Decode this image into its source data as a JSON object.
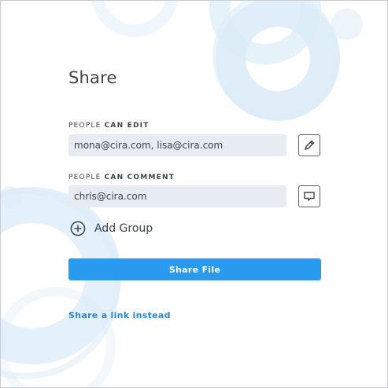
{
  "dialog": {
    "title": "Share",
    "edit_section": {
      "label_prefix": "PEOPLE",
      "label_emphasis": "CAN EDIT",
      "value": "mona@cira.com, lisa@cira.com",
      "icon": "pencil-icon"
    },
    "comment_section": {
      "label_prefix": "PEOPLE",
      "label_emphasis": "CAN COMMENT",
      "value": "chris@cira.com",
      "icon": "comment-icon"
    },
    "add_group": {
      "label": "Add Group",
      "icon": "plus-circle-icon"
    },
    "share_button": {
      "label": "Share File"
    },
    "share_link": {
      "label": "Share a link instead"
    }
  },
  "colors": {
    "accent": "#2a9aee",
    "link": "#2f86c9",
    "field_bg": "#e7ebf2",
    "text": "#3f4347",
    "decor": "#dcecf8"
  }
}
